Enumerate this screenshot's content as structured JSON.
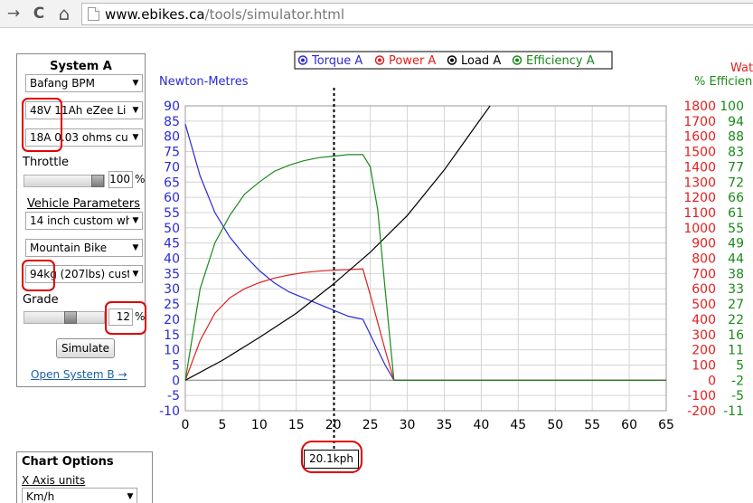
{
  "browser": {
    "nav": {
      "back": "→",
      "reload": "C",
      "home": "⌂"
    },
    "url_host": "www.ebikes.ca",
    "url_path": "/tools/simulator.html"
  },
  "system_a": {
    "title": "System A",
    "motor": "Bafang BPM",
    "battery": "48V 11Ah eZee Li",
    "controller": "18A 0.03 ohms cu",
    "throttle_label": "Throttle",
    "throttle_value": "100",
    "throttle_level": 1.0,
    "vehicle_params_label": "Vehicle Parameters",
    "wheel": "14 inch custom wh",
    "bike_type": "Mountain Bike",
    "weight": "94kg (207lbs) cust",
    "grade_label": "Grade",
    "grade_value": "12",
    "grade_level": 0.6,
    "percent": "%",
    "simulate_button": "Simulate",
    "open_system_b": "Open System B →"
  },
  "chart_options": {
    "title": "Chart Options",
    "x_axis_units_label": "X Axis units",
    "x_axis_units": "Km/h"
  },
  "speed_marker": "20.1kph",
  "chart_data": {
    "type": "line",
    "legend": [
      {
        "name": "Torque A",
        "color": "#2b2bd6"
      },
      {
        "name": "Power A",
        "color": "#e02020"
      },
      {
        "name": "Load A",
        "color": "#000000"
      },
      {
        "name": "Efficiency A",
        "color": "#1a8a1a"
      }
    ],
    "left_axis_title": "Newton-Metres",
    "right_axis_titles": [
      "Watts",
      "% Efficiency"
    ],
    "xlim": [
      0,
      65
    ],
    "ylim": [
      -10,
      90
    ],
    "x_ticks": [
      0,
      5,
      10,
      15,
      20,
      25,
      30,
      35,
      40,
      45,
      50,
      55,
      60,
      65
    ],
    "y_ticks": [
      -10,
      -5,
      0,
      5,
      10,
      15,
      20,
      25,
      30,
      35,
      40,
      45,
      50,
      55,
      60,
      65,
      70,
      75,
      80,
      85,
      90
    ],
    "watts_ticks": [
      "-200",
      "-100",
      "0",
      "100",
      "200",
      "300",
      "400",
      "500",
      "600",
      "700",
      "800",
      "900",
      "1000",
      "1100",
      "1200",
      "1300",
      "1400",
      "1500",
      "1600",
      "1700",
      "1800"
    ],
    "efficiency_ticks": [
      "-11",
      "-5",
      "-2",
      "5",
      "11",
      "16",
      "22",
      "27",
      "33",
      "38",
      "44",
      "49",
      "55",
      "61",
      "66",
      "72",
      "77",
      "83",
      "88",
      "94",
      "100"
    ],
    "marker_x": 20.1,
    "grid": true,
    "series": [
      {
        "name": "Torque A",
        "x": [
          0,
          2,
          4,
          6,
          8,
          10,
          12,
          14,
          16,
          18,
          20,
          22,
          24,
          25,
          26,
          27,
          28.2,
          30,
          65
        ],
        "y": [
          84,
          67,
          55,
          47,
          41,
          36,
          32,
          29,
          27,
          25,
          23,
          21,
          20,
          15,
          10,
          5,
          0,
          0,
          0
        ]
      },
      {
        "name": "Power A",
        "x": [
          0,
          2,
          4,
          6,
          8,
          10,
          12,
          14,
          16,
          18,
          20,
          22,
          24,
          25,
          26,
          27,
          28.2,
          30,
          65
        ],
        "y": [
          0,
          13,
          22,
          27,
          30,
          32,
          33.5,
          34.5,
          35.3,
          35.8,
          36.1,
          36.3,
          36.5,
          28,
          19,
          10,
          0,
          0,
          0
        ]
      },
      {
        "name": "Load A",
        "x": [
          0,
          5,
          10,
          15,
          20,
          25,
          30,
          35,
          40,
          41.2
        ],
        "y": [
          0,
          6.5,
          14,
          22,
          31.5,
          42,
          54,
          69,
          86,
          90
        ]
      },
      {
        "name": "Efficiency A",
        "x": [
          0,
          2,
          4,
          6,
          8,
          10,
          12,
          14,
          16,
          18,
          20,
          22,
          24,
          25,
          26,
          27,
          28.2,
          30,
          65
        ],
        "y": [
          0,
          30,
          45,
          54,
          61,
          65,
          68.5,
          70.5,
          72,
          73,
          73.5,
          74,
          74,
          70,
          56,
          30,
          0,
          0,
          0
        ]
      }
    ]
  }
}
